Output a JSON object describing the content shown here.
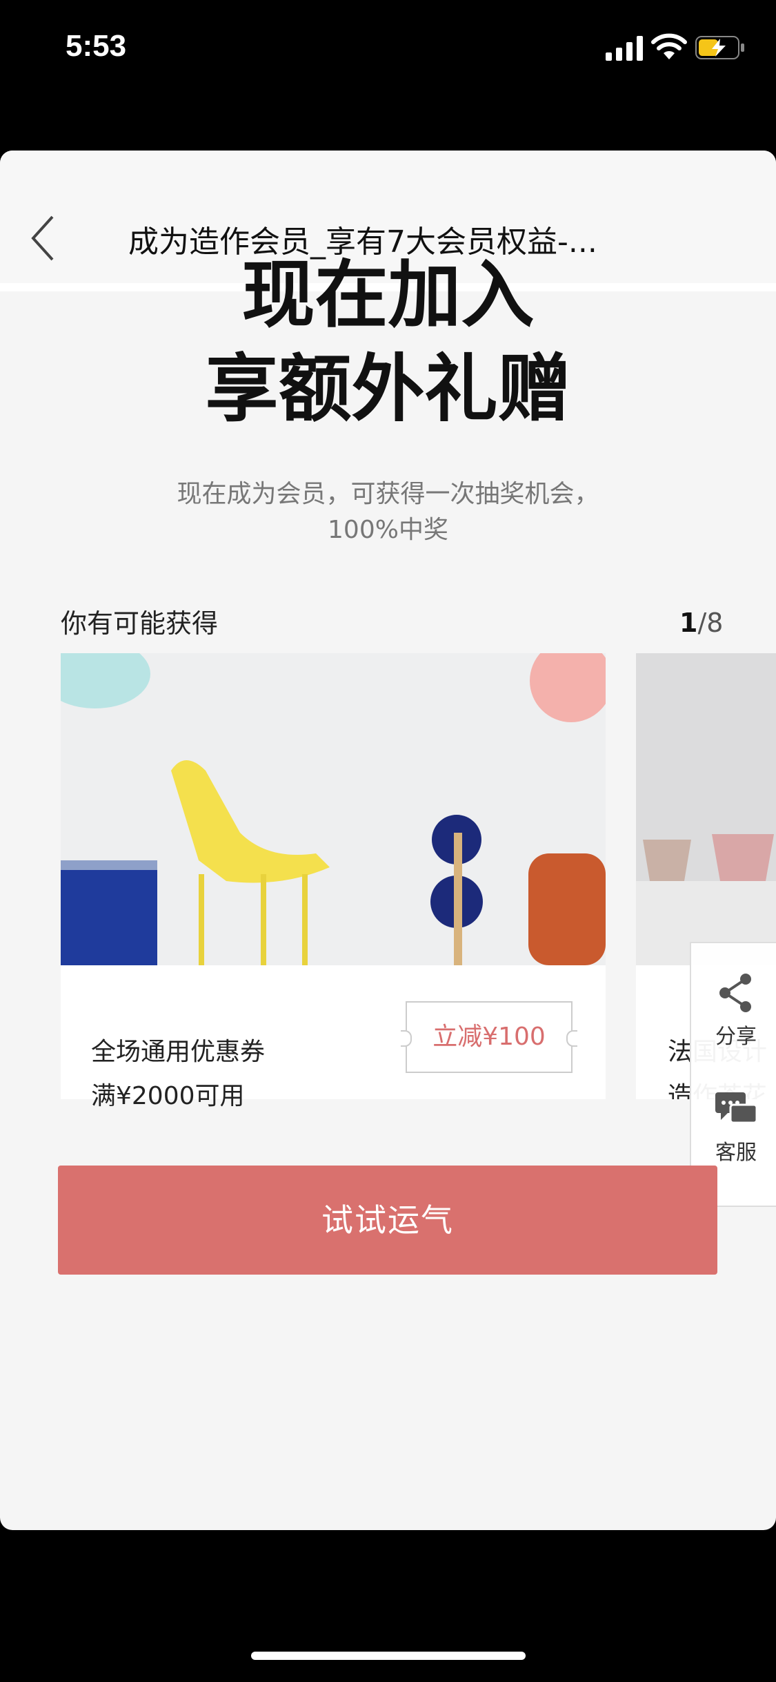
{
  "status_bar": {
    "time": "5:53"
  },
  "navbar": {
    "title": "成为造作会员_享有7大会员权益-..."
  },
  "hero": {
    "line1": "现在加入",
    "line2": "享额外礼赠"
  },
  "subtitle": {
    "line1": "现在成为会员，可获得一次抽奖机会，",
    "line2": "100%中奖"
  },
  "section": {
    "label": "你有可能获得",
    "pager_current": "1",
    "pager_total": "/8"
  },
  "cards": [
    {
      "line1": "全场通用优惠券",
      "line2": "满¥2000可用",
      "tag": "立减¥100"
    },
    {
      "line1": "法国设计",
      "line2": "造作茶花"
    }
  ],
  "float_panel": {
    "share_label": "分享",
    "service_label": "客服"
  },
  "cta": {
    "label": "试试运气"
  },
  "colors": {
    "accent": "#d9716e",
    "tag_text": "#d86e6e"
  }
}
